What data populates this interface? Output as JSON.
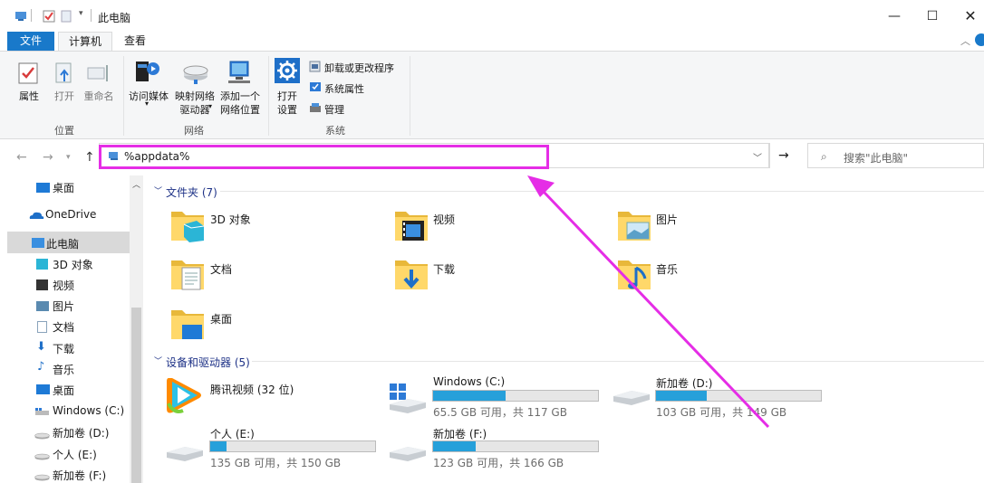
{
  "window": {
    "title": "此电脑"
  },
  "ribbon_tabs": {
    "file": "文件",
    "computer": "计算机",
    "view": "查看"
  },
  "ribbon": {
    "properties": "属性",
    "open": "打开",
    "rename": "重命名",
    "access_media": "访问媒体",
    "map_drive_line1": "映射网络",
    "map_drive_line2": "驱动器",
    "add_location_line1": "添加一个",
    "add_location_line2": "网络位置",
    "open_settings_line1": "打开",
    "open_settings_line2": "设置",
    "uninstall": "卸载或更改程序",
    "system_properties": "系统属性",
    "manage": "管理",
    "group_location": "位置",
    "group_network": "网络",
    "group_system": "系统"
  },
  "address": {
    "path": "%appdata%",
    "search_placeholder": "搜索\"此电脑\""
  },
  "nav": {
    "items": [
      {
        "label": "桌面"
      },
      {
        "label": "OneDrive"
      },
      {
        "label": "此电脑"
      },
      {
        "label": "3D 对象"
      },
      {
        "label": "视频"
      },
      {
        "label": "图片"
      },
      {
        "label": "文档"
      },
      {
        "label": "下载"
      },
      {
        "label": "音乐"
      },
      {
        "label": "桌面"
      },
      {
        "label": "Windows (C:)"
      },
      {
        "label": "新加卷 (D:)"
      },
      {
        "label": "个人 (E:)"
      },
      {
        "label": "新加卷 (F:)"
      }
    ]
  },
  "folders_section": {
    "title": "文件夹 (7)",
    "items": [
      {
        "name": "3D 对象"
      },
      {
        "name": "视频"
      },
      {
        "name": "图片"
      },
      {
        "name": "文档"
      },
      {
        "name": "下载"
      },
      {
        "name": "音乐"
      },
      {
        "name": "桌面"
      }
    ]
  },
  "drives_section": {
    "title": "设备和驱动器 (5)",
    "items": [
      {
        "name": "腾讯视频 (32 位)"
      },
      {
        "name": "Windows (C:)",
        "free_text": "65.5 GB 可用，共 117 GB",
        "used_fraction": 0.44
      },
      {
        "name": "新加卷 (D:)",
        "free_text": "103 GB 可用，共 149 GB",
        "used_fraction": 0.31
      },
      {
        "name": "个人 (E:)",
        "free_text": "135 GB 可用，共 150 GB",
        "used_fraction": 0.1
      },
      {
        "name": "新加卷 (F:)",
        "free_text": "123 GB 可用，共 166 GB",
        "used_fraction": 0.26
      }
    ]
  },
  "colors": {
    "accent": "#1979ca",
    "highlight": "#e52de6",
    "bar": "#26a0da"
  }
}
